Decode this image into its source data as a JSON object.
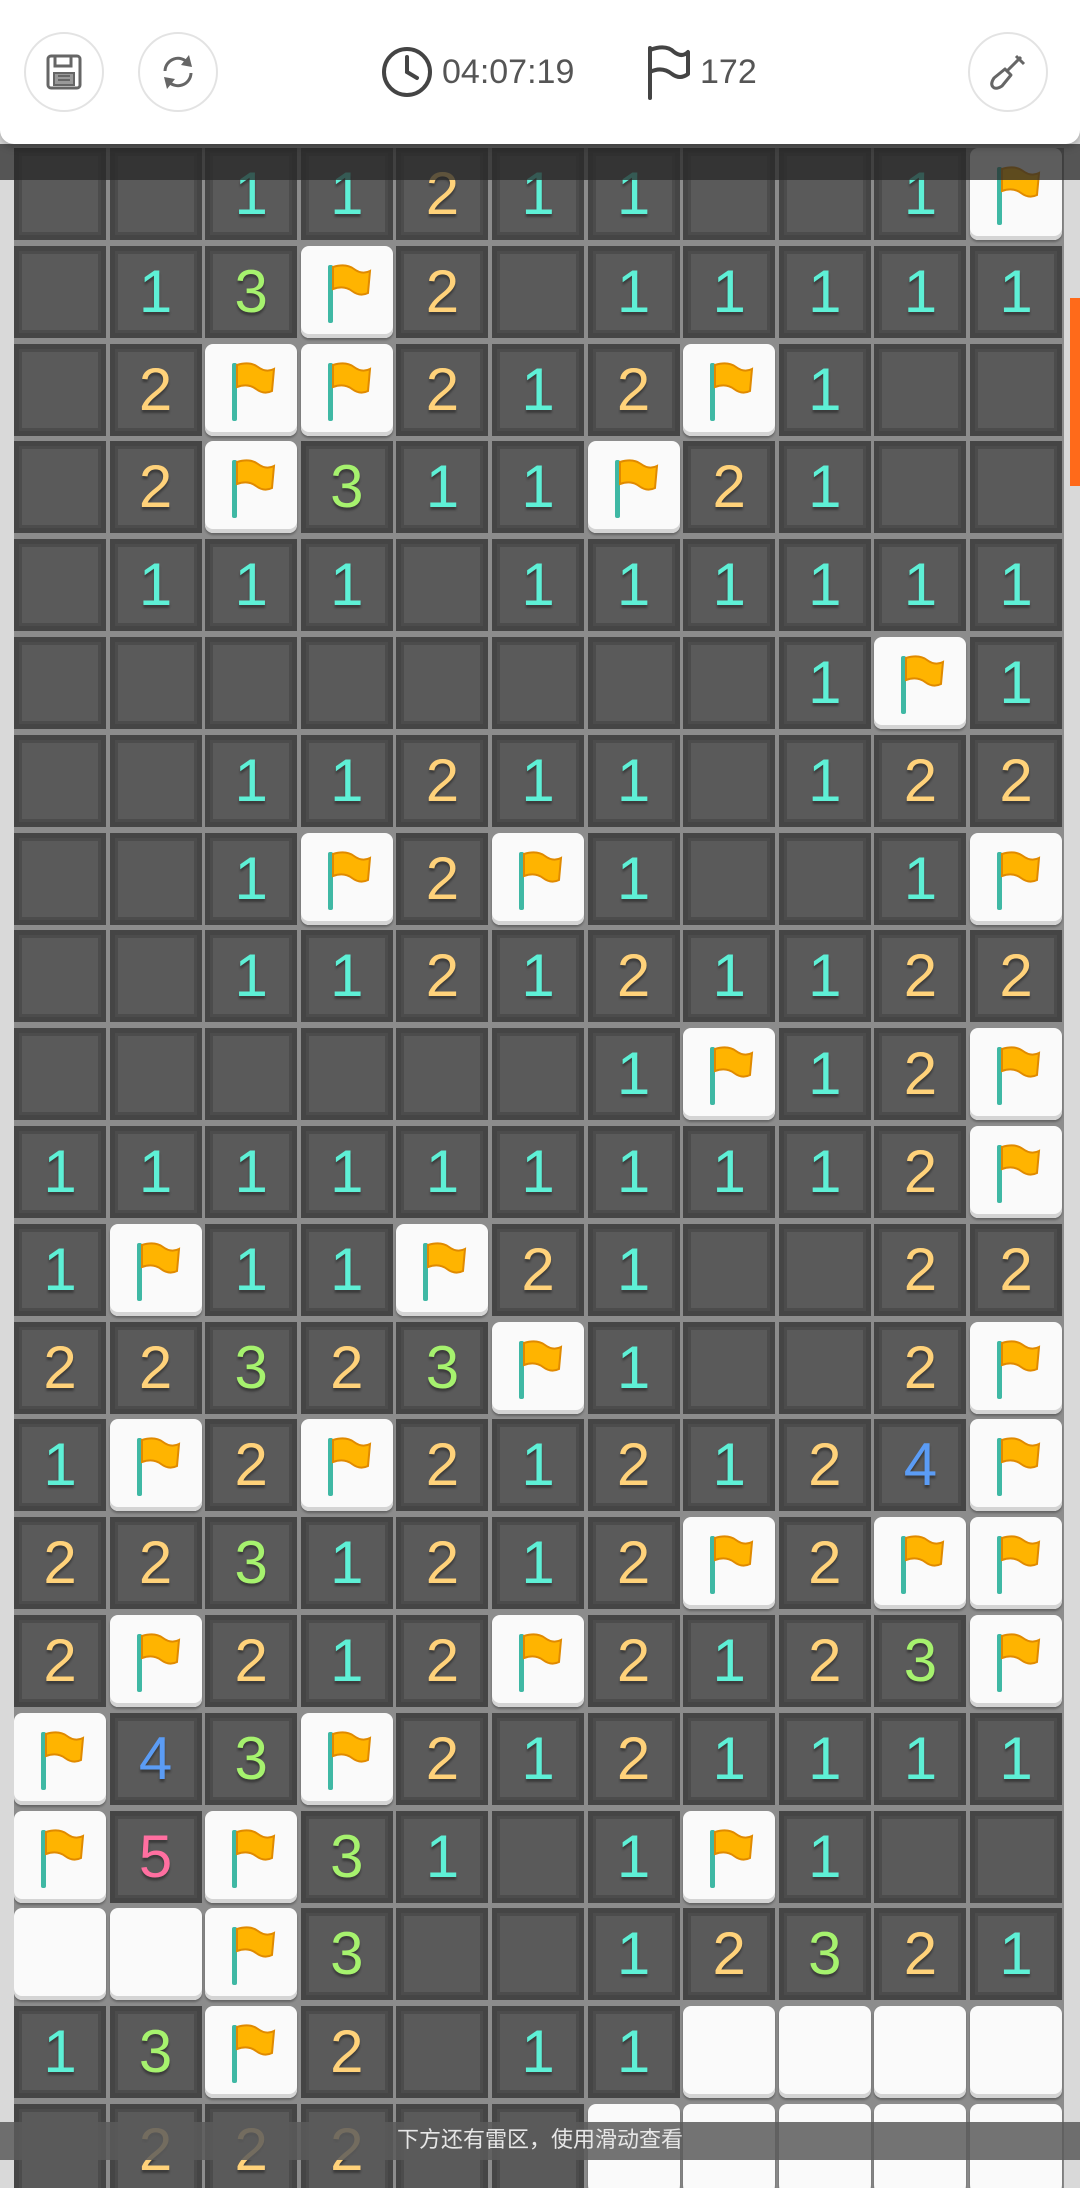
{
  "header": {
    "timer": "04:07:19",
    "flags_remaining": "172",
    "icons": {
      "save": "save-icon",
      "restart": "refresh-icon",
      "timer": "clock-icon",
      "flag": "flag-icon",
      "shovel": "shovel-icon"
    }
  },
  "board": {
    "rows": [
      [
        "_",
        "_",
        "1",
        "1",
        "2",
        "1",
        "1",
        "_",
        "_",
        "1",
        "F"
      ],
      [
        "_",
        "1",
        "3",
        "F",
        "2",
        "_",
        "1",
        "1",
        "1",
        "1",
        "1"
      ],
      [
        "_",
        "2",
        "F",
        "F",
        "2",
        "1",
        "2",
        "F",
        "1",
        "_",
        "_"
      ],
      [
        "_",
        "2",
        "F",
        "3",
        "1",
        "1",
        "F",
        "2",
        "1",
        "_",
        "_"
      ],
      [
        "_",
        "1",
        "1",
        "1",
        "_",
        "1",
        "1",
        "1",
        "1",
        "1",
        "1"
      ],
      [
        "_",
        "_",
        "_",
        "_",
        "_",
        "_",
        "_",
        "_",
        "1",
        "F",
        "1"
      ],
      [
        "_",
        "_",
        "1",
        "1",
        "2",
        "1",
        "1",
        "_",
        "1",
        "2",
        "2"
      ],
      [
        "_",
        "_",
        "1",
        "F",
        "2",
        "F",
        "1",
        "_",
        "_",
        "1",
        "F"
      ],
      [
        "_",
        "_",
        "1",
        "1",
        "2",
        "1",
        "2",
        "1",
        "1",
        "2",
        "2"
      ],
      [
        "_",
        "_",
        "_",
        "_",
        "_",
        "_",
        "1",
        "F",
        "1",
        "2",
        "F"
      ],
      [
        "1",
        "1",
        "1",
        "1",
        "1",
        "1",
        "1",
        "1",
        "1",
        "2",
        "F"
      ],
      [
        "1",
        "F",
        "1",
        "1",
        "F",
        "2",
        "1",
        "_",
        "_",
        "2",
        "2"
      ],
      [
        "2",
        "2",
        "3",
        "2",
        "3",
        "F",
        "1",
        "_",
        "_",
        "2",
        "F"
      ],
      [
        "1",
        "F",
        "2",
        "F",
        "2",
        "1",
        "2",
        "1",
        "2",
        "4",
        "F"
      ],
      [
        "2",
        "2",
        "3",
        "1",
        "2",
        "1",
        "2",
        "F",
        "2",
        "F",
        "F"
      ],
      [
        "2",
        "F",
        "2",
        "1",
        "2",
        "F",
        "2",
        "1",
        "2",
        "3",
        "F"
      ],
      [
        "F",
        "4",
        "3",
        "F",
        "2",
        "1",
        "2",
        "1",
        "1",
        "1",
        "1"
      ],
      [
        "F",
        "5",
        "F",
        "3",
        "1",
        "_",
        "1",
        "F",
        "1",
        "_",
        "_"
      ],
      [
        "O",
        "O",
        "F",
        "3",
        "_",
        "_",
        "1",
        "2",
        "3",
        "2",
        "1"
      ],
      [
        "1",
        "3",
        "F",
        "2",
        "_",
        "1",
        "1",
        "O",
        "O",
        "O",
        "O"
      ],
      [
        "_",
        "2",
        "2",
        "2",
        "_",
        "_",
        "O",
        "O",
        "O",
        "O",
        "O"
      ]
    ]
  },
  "colors": {
    "1": "#5ef0d6",
    "2": "#ffd27a",
    "3": "#a6f26e",
    "4": "#5b9cf5",
    "5": "#ff6fa0",
    "flag": "#ffb400",
    "pole": "#3fb8a4"
  },
  "hint": "下方还有雷区，使用滑动查看"
}
